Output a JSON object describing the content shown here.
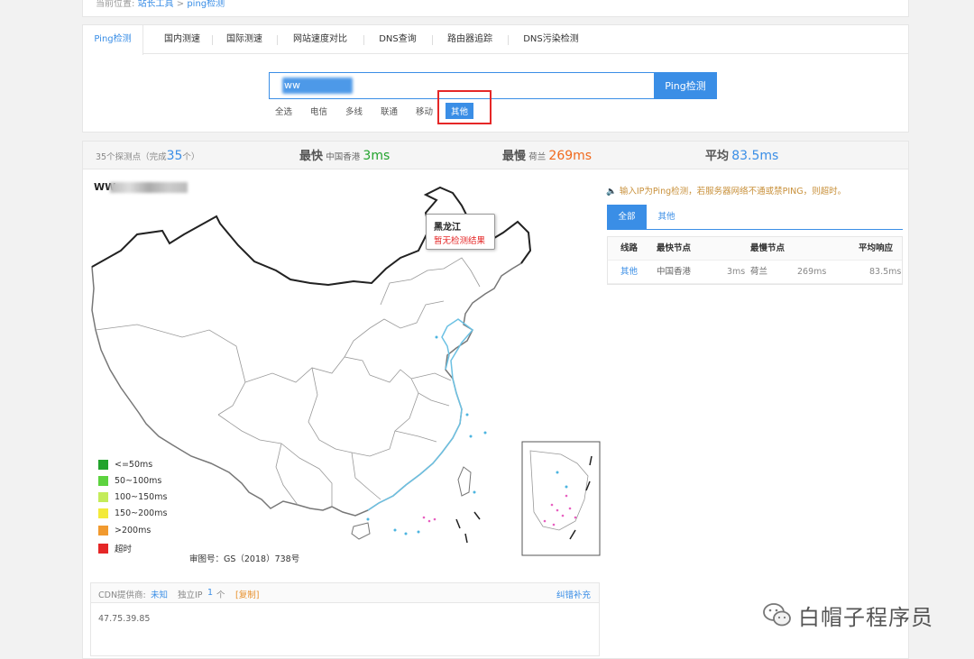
{
  "breadcrumb": {
    "prefix": "当前位置:",
    "link1": "站长工具",
    "sep": ">",
    "current": "ping检测"
  },
  "tabs": [
    {
      "label": "Ping检测",
      "active": true
    },
    {
      "label": "国内测速"
    },
    {
      "label": "国际测速"
    },
    {
      "label": "网站速度对比"
    },
    {
      "label": "DNS查询"
    },
    {
      "label": "路由器追踪"
    },
    {
      "label": "DNS污染检测"
    }
  ],
  "search": {
    "value": "ww",
    "button_label": "Ping检测"
  },
  "filters": [
    "全选",
    "电信",
    "多线",
    "联通",
    "移动",
    "其他"
  ],
  "filters_active": "其他",
  "stats": {
    "points_prefix": "35个探测点（完成",
    "points_done": "35",
    "points_suffix": "个）",
    "fastest_label": "最快",
    "fastest_loc": "中国香港",
    "fastest_ms": "3ms",
    "slowest_label": "最慢",
    "slowest_loc": "荷兰",
    "slowest_ms": "269ms",
    "avg_label": "平均",
    "avg_ms": "83.5ms"
  },
  "map": {
    "host_prefix": "WW",
    "tooltip_title": "黑龙江",
    "tooltip_text": "暂无检测结果",
    "review_no": "审图号：GS（2018）738号"
  },
  "legend": [
    {
      "label": "<=50ms",
      "color": "#22a32d"
    },
    {
      "label": "50~100ms",
      "color": "#5dd33f"
    },
    {
      "label": "100~150ms",
      "color": "#c4ec5a"
    },
    {
      "label": "150~200ms",
      "color": "#f3ea3a"
    },
    {
      "label": ">200ms",
      "color": "#f19a2f"
    },
    {
      "label": "超时",
      "color": "#e52727"
    }
  ],
  "cdn": {
    "provider_label": "CDN提供商:",
    "provider_value": "未知",
    "ip_label": "独立IP",
    "ip_count": "1",
    "ip_unit": "个",
    "copy": "[复制]",
    "feedback": "纠错补充",
    "ip": "47.75.39.85"
  },
  "notice": "输入IP为Ping检测，若服务器网络不通或禁PING，则超时。",
  "result_tabs": [
    "全部",
    "其他"
  ],
  "table": {
    "headers": [
      "线路",
      "最快节点",
      "最慢节点",
      "平均响应"
    ],
    "rows": [
      {
        "line": "其他",
        "fast_node": "中国香港",
        "fast_ms": "3ms",
        "slow_node": "荷兰",
        "slow_ms": "269ms",
        "avg": "83.5ms"
      }
    ]
  },
  "watermark": "白帽子程序员",
  "colors": {
    "accent": "#3a8ee6",
    "fastest": "#22a32d",
    "slowest": "#f06a1e",
    "highlight_box": "#e52727"
  }
}
